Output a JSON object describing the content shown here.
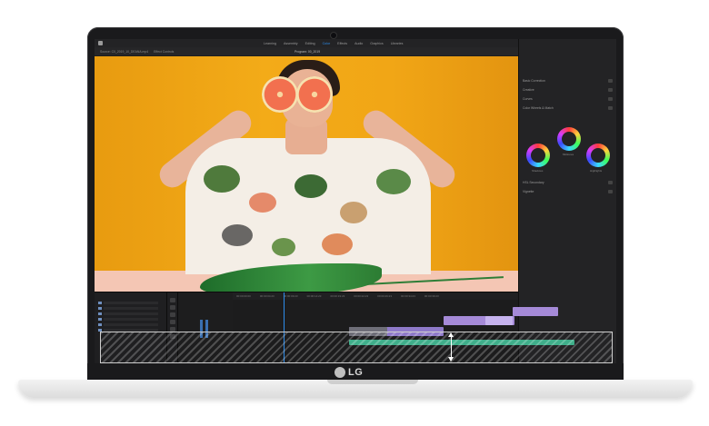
{
  "device": {
    "brand": "LG"
  },
  "app": {
    "menu": [
      "Learning",
      "Assembly",
      "Editing",
      "Color",
      "Effects",
      "Audio",
      "Graphics",
      "Libraries"
    ],
    "active_menu_index": 3,
    "source_tab": "Source: C0_2019_10_DEANA.mp4",
    "effect_controls_tab": "Effect Controls",
    "program_tab": "Program: 00_2019",
    "accent_color": "#2d8ceb"
  },
  "lumetri": {
    "rows": [
      "Basic Correction",
      "Creative",
      "Curves",
      "Color Wheels & Match",
      "HSL Secondary",
      "Vignette"
    ],
    "wheel_labels": [
      "Shadows",
      "Midtones",
      "Highlights"
    ]
  },
  "timeline": {
    "ruler": [
      "00:00:00:00",
      "00:00:04:23",
      "00:00:09:23",
      "00:00:14:23",
      "00:00:19:23",
      "00:00:24:23",
      "00:00:29:23",
      "00:00:34:23",
      "00:00:39:23"
    ],
    "clip_colors": {
      "video": "#a58ad8",
      "audio": "#3fae8a",
      "selected": "#8f7ac9"
    }
  },
  "icons": {
    "resize_arrow": "vertical-double-arrow-icon",
    "brand_logo": "lg-logo-icon"
  }
}
